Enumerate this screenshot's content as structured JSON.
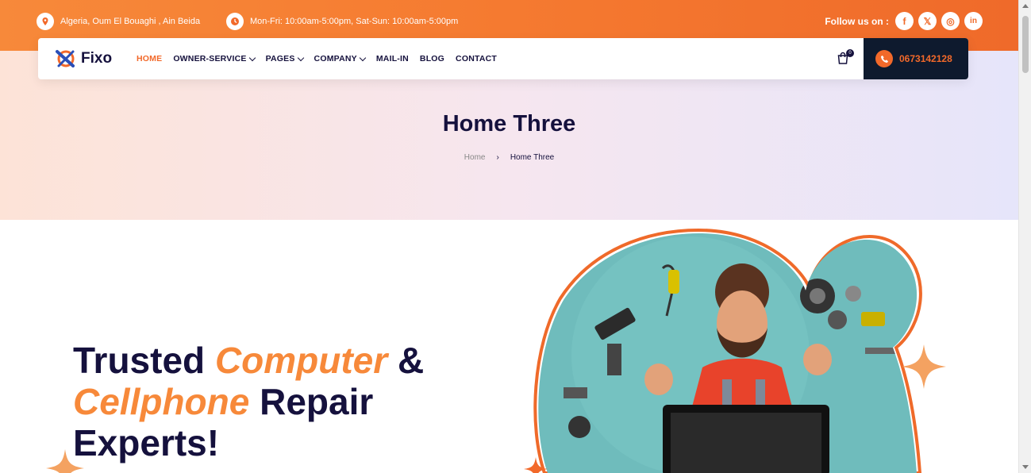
{
  "topbar": {
    "address": "Algeria, Oum El Bouaghi , Ain Beida",
    "hours": "Mon-Fri: 10:00am-5:00pm, Sat-Sun: 10:00am-5:00pm",
    "follow_label": "Follow us on :",
    "socials": [
      {
        "icon": "facebook-icon",
        "glyph": "f"
      },
      {
        "icon": "x-icon",
        "glyph": "𝕏"
      },
      {
        "icon": "instagram-icon",
        "glyph": "◎"
      },
      {
        "icon": "linkedin-icon",
        "glyph": "in"
      }
    ]
  },
  "nav": {
    "logo": "Fixo",
    "items": [
      {
        "label": "HOME",
        "active": true,
        "dropdown": false
      },
      {
        "label": "OWNER-SERVICE",
        "dropdown": true
      },
      {
        "label": "PAGES",
        "dropdown": true
      },
      {
        "label": "COMPANY",
        "dropdown": true
      },
      {
        "label": "MAIL-IN",
        "dropdown": false
      },
      {
        "label": "BLOG",
        "dropdown": false
      },
      {
        "label": "CONTACT",
        "dropdown": false
      }
    ],
    "cart_count": "0",
    "phone": "0673142128"
  },
  "page": {
    "title": "Home Three",
    "breadcrumb_home": "Home",
    "breadcrumb_current": "Home Three"
  },
  "hero": {
    "line1_a": "Trusted ",
    "line1_b": "Computer",
    "line1_c": " &",
    "line2_a": "Cellphone",
    "line2_b": " Repair",
    "line3": "Experts!"
  },
  "colors": {
    "accent": "#f2692a",
    "navy": "#15113d",
    "teal": "#5fb3b3"
  }
}
